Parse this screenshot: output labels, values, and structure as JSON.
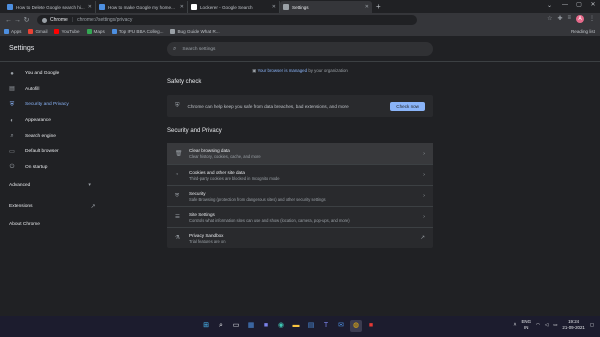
{
  "tabs": [
    {
      "title": "How to Delete Google search hi...",
      "favicon_color": "#4d8fe0",
      "active": false
    },
    {
      "title": "How to make Google my home...",
      "favicon_color": "#4d8fe0",
      "active": false
    },
    {
      "title": "Lockerer - Google Search",
      "favicon_color": "#ffffff",
      "active": false
    },
    {
      "title": "Settings",
      "favicon_color": "#9aa0a6",
      "active": true
    }
  ],
  "address_bar": {
    "scheme": "Chrome",
    "url": "chrome://settings/privacy"
  },
  "bookmarks": [
    {
      "label": "Apps",
      "color": "#4d8fe0"
    },
    {
      "label": "Gmail",
      "color": "#ea4335"
    },
    {
      "label": "YouTube",
      "color": "#ff0000"
    },
    {
      "label": "Maps",
      "color": "#34a853"
    },
    {
      "label": "Top IPU BBA Colleg...",
      "color": "#4d8fe0"
    },
    {
      "label": "Bug Guide What R...",
      "color": "#9aa0a6"
    }
  ],
  "reading_list": "Reading list",
  "avatar_letter": "A",
  "settings_title": "Settings",
  "search_placeholder": "Search settings",
  "sidebar": {
    "items": [
      {
        "label": "You and Google",
        "icon": "person-icon"
      },
      {
        "label": "Autofill",
        "icon": "autofill-icon"
      },
      {
        "label": "Security and Privacy",
        "icon": "shield-icon",
        "selected": true
      },
      {
        "label": "Appearance",
        "icon": "palette-icon"
      },
      {
        "label": "Search engine",
        "icon": "search-icon"
      },
      {
        "label": "Default browser",
        "icon": "browser-icon"
      },
      {
        "label": "On startup",
        "icon": "power-icon"
      }
    ],
    "advanced": "Advanced",
    "extensions": "Extensions",
    "about": "About Chrome"
  },
  "managed_notice": {
    "link": "Your browser is managed",
    "rest": "by your organization"
  },
  "safety_check": {
    "title": "Safety check",
    "message": "Chrome can help keep you safe from data breaches, bad extensions, and more",
    "button": "Check now"
  },
  "privacy": {
    "title": "Security and Privacy",
    "rows": [
      {
        "title": "Clear browsing data",
        "desc": "Clear history, cookies, cache, and more",
        "icon": "trash-icon",
        "trailing": "arrow"
      },
      {
        "title": "Cookies and other site data",
        "desc": "Third-party cookies are blocked in Incognito mode",
        "icon": "cookie-icon",
        "trailing": "arrow"
      },
      {
        "title": "Security",
        "desc": "Safe Browsing (protection from dangerous sites) and other security settings",
        "icon": "shield-icon",
        "trailing": "arrow"
      },
      {
        "title": "Site Settings",
        "desc": "Controls what information sites can use and show (location, camera, pop-ups, and more)",
        "icon": "sliders-icon",
        "trailing": "arrow"
      },
      {
        "title": "Privacy Sandbox",
        "desc": "Trial features are on",
        "icon": "flask-icon",
        "trailing": "external"
      }
    ]
  },
  "taskbar": {
    "lang": "ENG",
    "lang_sub": "IN",
    "time": "19:24",
    "date": "21-09-2021"
  }
}
